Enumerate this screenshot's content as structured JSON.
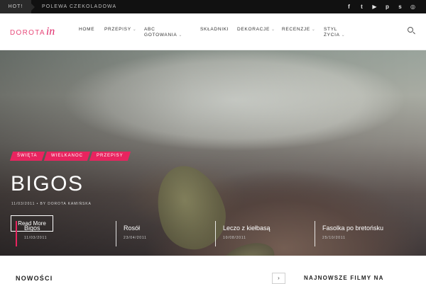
{
  "topbar": {
    "hot_label": "HOT!",
    "ticker_text": "Polewa czekoladowa",
    "social_icons": [
      "facebook-icon",
      "twitter-icon",
      "youtube-icon",
      "pinterest-icon",
      "stumbleupon-icon",
      "instagram-icon"
    ],
    "social_glyphs": [
      "f",
      "t",
      "▶",
      "p",
      "s",
      "◎"
    ]
  },
  "header": {
    "logo_text": "DOROTA",
    "logo_script": "in",
    "nav": [
      {
        "label": "Home",
        "chevron": ""
      },
      {
        "label": "Przepisy",
        "chevron": "⌄"
      },
      {
        "label": "ABC",
        "label2": "gotowania",
        "chevron": "⌄"
      },
      {
        "label": "Składniki",
        "chevron": ""
      },
      {
        "label": "Dekoracje",
        "chevron": "⌄"
      },
      {
        "label": "Recenzje",
        "chevron": "⌄"
      },
      {
        "label": "Styl",
        "label2": "życia",
        "chevron": "⌄"
      }
    ]
  },
  "hero": {
    "tags": [
      "Święta",
      "Wielkanoc",
      "Przepisy"
    ],
    "title": "BIGOS",
    "date": "11/03/2011",
    "author_prefix": "•   by",
    "author": "Dorota Kamińska",
    "button_label": "Read More"
  },
  "slides": [
    {
      "title": "Bigos",
      "date": "11/03/2011"
    },
    {
      "title": "Rosół",
      "date": "23/04/2011"
    },
    {
      "title": "Leczo z kiełbasą",
      "date": "10/08/2011"
    },
    {
      "title": "Fasolka po bretońsku",
      "date": "25/10/2011"
    }
  ],
  "bottom": {
    "news_title": "NOWOŚCI",
    "next_glyph": "›",
    "sidebar_title": "NAJNOWSZE FILMY NA"
  },
  "colors": {
    "accent": "#e8245f",
    "topbar": "#111111",
    "logo": "#e84a7a"
  }
}
